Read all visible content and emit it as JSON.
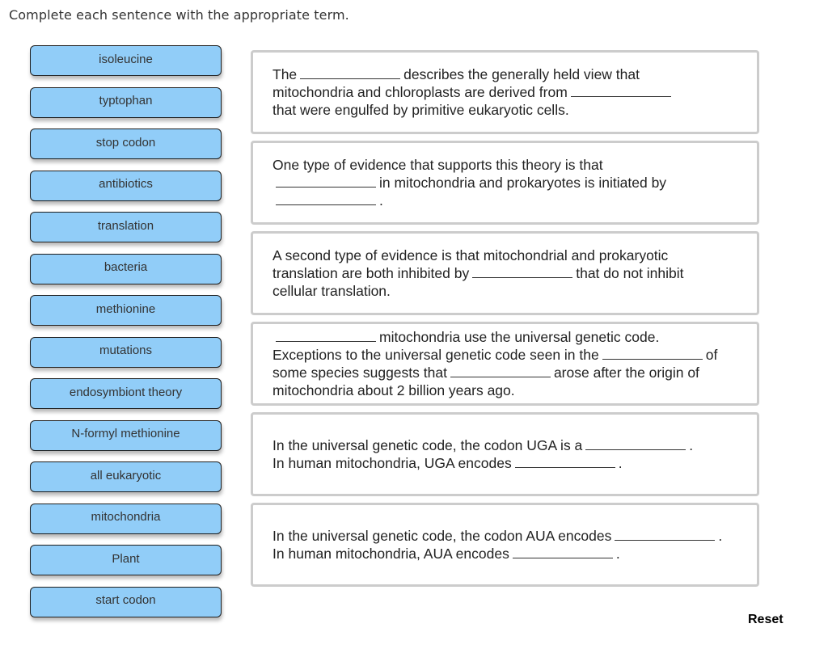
{
  "instruction": "Complete each sentence with the appropriate term.",
  "terms": [
    "isoleucine",
    "typtophan",
    "stop codon",
    "antibiotics",
    "translation",
    "bacteria",
    "methionine",
    "mutations",
    "endosymbiont theory",
    "N-formyl methionine",
    "all eukaryotic",
    "mitochondria",
    "Plant",
    "start codon"
  ],
  "sentences": [
    {
      "lines": [
        [
          {
            "t": "The"
          },
          {
            "blank": true
          },
          {
            "t": "describes the generally held view that"
          }
        ],
        [
          {
            "t": "mitochondria and chloroplasts are derived from"
          },
          {
            "blank": true
          }
        ],
        [
          {
            "t": "that were engulfed by primitive eukaryotic cells."
          }
        ]
      ]
    },
    {
      "lines": [
        [
          {
            "t": "One type of evidence that supports this theory is that"
          }
        ],
        [
          {
            "blank": true
          },
          {
            "t": "in mitochondria and prokaryotes is initiated by"
          }
        ],
        [
          {
            "blank": true
          },
          {
            "t": "."
          }
        ]
      ]
    },
    {
      "lines": [
        [
          {
            "t": "A second type of evidence is that mitochondrial and prokaryotic"
          }
        ],
        [
          {
            "t": "translation are both inhibited by"
          },
          {
            "blank": true
          },
          {
            "t": "that do not inhibit"
          }
        ],
        [
          {
            "t": "cellular translation."
          }
        ]
      ]
    },
    {
      "lines": [
        [
          {
            "blank": true
          },
          {
            "t": "mitochondria use the universal genetic code."
          }
        ],
        [
          {
            "t": "Exceptions to the universal genetic code seen in the"
          },
          {
            "blank": true
          },
          {
            "t": "of"
          }
        ],
        [
          {
            "t": "some species suggests that"
          },
          {
            "blank": true
          },
          {
            "t": "arose after the origin of"
          }
        ],
        [
          {
            "t": "mitochondria about 2 billion years ago."
          }
        ]
      ]
    },
    {
      "lines": [
        [
          {
            "t": "In the universal genetic code, the codon UGA is a"
          },
          {
            "blank": true
          },
          {
            "t": "."
          }
        ],
        [
          {
            "t": "In human mitochondria, UGA encodes"
          },
          {
            "blank": true
          },
          {
            "t": "."
          }
        ]
      ]
    },
    {
      "lines": [
        [
          {
            "t": "In the universal genetic code, the codon AUA encodes"
          },
          {
            "blank": true
          },
          {
            "t": "."
          }
        ],
        [
          {
            "t": "In human mitochondria, AUA encodes"
          },
          {
            "blank": true
          },
          {
            "t": "."
          }
        ]
      ]
    }
  ],
  "reset_label": "Reset",
  "colors": {
    "term_fill": "#91cdf8",
    "term_border": "#1e1e1e",
    "box_border": "#cccccc"
  }
}
